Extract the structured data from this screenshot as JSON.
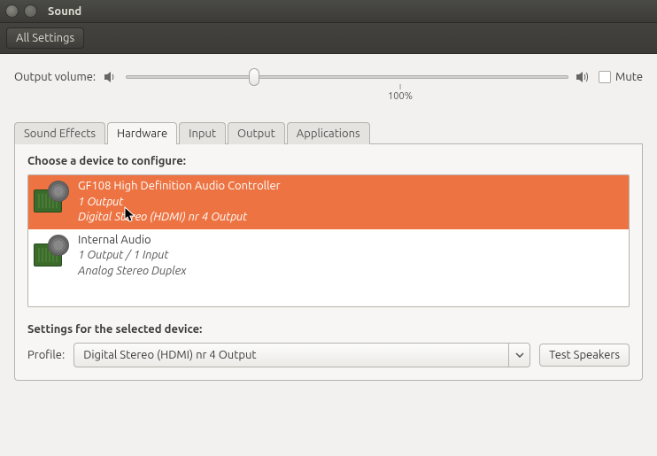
{
  "window": {
    "title": "Sound"
  },
  "toolbar": {
    "all_settings": "All Settings"
  },
  "volume": {
    "label": "Output volume:",
    "mute_label": "Mute",
    "muted": false,
    "thumb_percent": 29,
    "tick_label": "100%",
    "tick_position_percent": 62
  },
  "tabs": [
    {
      "label": "Sound Effects",
      "id": "sound-effects"
    },
    {
      "label": "Hardware",
      "id": "hardware"
    },
    {
      "label": "Input",
      "id": "input"
    },
    {
      "label": "Output",
      "id": "output"
    },
    {
      "label": "Applications",
      "id": "applications"
    }
  ],
  "active_tab": "hardware",
  "hardware": {
    "choose_label": "Choose a device to configure:",
    "devices": [
      {
        "name": "GF108 High Definition Audio Controller",
        "io": "1 Output",
        "profile": "Digital Stereo (HDMI) nr 4 Output",
        "selected": true
      },
      {
        "name": "Internal Audio",
        "io": "1 Output / 1 Input",
        "profile": "Analog Stereo Duplex",
        "selected": false
      }
    ],
    "settings_label": "Settings for the selected device:",
    "profile_label": "Profile:",
    "profile_value": "Digital Stereo (HDMI) nr 4 Output",
    "test_speakers": "Test Speakers"
  }
}
